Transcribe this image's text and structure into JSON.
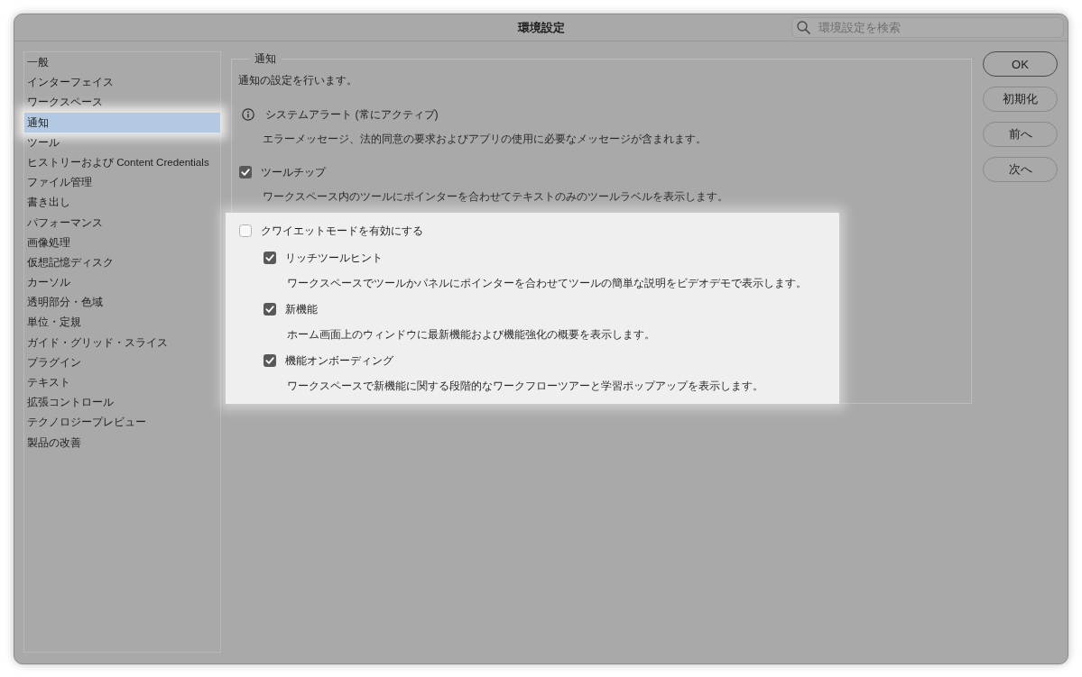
{
  "window": {
    "title": "環境設定"
  },
  "search": {
    "placeholder": "環境設定を検索"
  },
  "sidebar": {
    "items": [
      {
        "label": "一般",
        "selected": false,
        "highlighted": false
      },
      {
        "label": "インターフェイス",
        "selected": false,
        "highlighted": false
      },
      {
        "label": "ワークスペース",
        "selected": false,
        "highlighted": false
      },
      {
        "label": "通知",
        "selected": true,
        "highlighted": true
      },
      {
        "label": "ツール",
        "selected": false,
        "highlighted": false
      },
      {
        "label": "ヒストリーおよび Content Credentials",
        "selected": false,
        "highlighted": false
      },
      {
        "label": "ファイル管理",
        "selected": false,
        "highlighted": false
      },
      {
        "label": "書き出し",
        "selected": false,
        "highlighted": false
      },
      {
        "label": "パフォーマンス",
        "selected": false,
        "highlighted": false
      },
      {
        "label": "画像処理",
        "selected": false,
        "highlighted": false
      },
      {
        "label": "仮想記憶ディスク",
        "selected": false,
        "highlighted": false
      },
      {
        "label": "カーソル",
        "selected": false,
        "highlighted": false
      },
      {
        "label": "透明部分・色域",
        "selected": false,
        "highlighted": false
      },
      {
        "label": "単位・定規",
        "selected": false,
        "highlighted": false
      },
      {
        "label": "ガイド・グリッド・スライス",
        "selected": false,
        "highlighted": false
      },
      {
        "label": "プラグイン",
        "selected": false,
        "highlighted": false
      },
      {
        "label": "テキスト",
        "selected": false,
        "highlighted": false
      },
      {
        "label": "拡張コントロール",
        "selected": false,
        "highlighted": false
      },
      {
        "label": "テクノロジープレビュー",
        "selected": false,
        "highlighted": false
      },
      {
        "label": "製品の改善",
        "selected": false,
        "highlighted": false
      }
    ]
  },
  "panel": {
    "legend": "通知",
    "intro": "通知の設定を行います。",
    "settings": [
      {
        "kind": "info",
        "label": "システムアラート (常にアクティブ)",
        "description": "エラーメッセージ、法的同意の要求およびアプリの使用に必要なメッセージが含まれます。",
        "highlighted": false
      },
      {
        "kind": "checkbox",
        "label": "ツールチップ",
        "checked": true,
        "description": "ワークスペース内のツールにポインターを合わせてテキストのみのツールラベルを表示します。",
        "highlighted": false
      },
      {
        "kind": "checkbox",
        "label": "クワイエットモードを有効にする",
        "checked": false,
        "highlighted": true,
        "children": [
          {
            "kind": "checkbox",
            "label": "リッチツールヒント",
            "checked": true,
            "description": "ワークスペースでツールかパネルにポインターを合わせてツールの簡単な説明をビデオデモで表示します。"
          },
          {
            "kind": "checkbox",
            "label": "新機能",
            "checked": true,
            "description": "ホーム画面上のウィンドウに最新機能および機能強化の概要を表示します。"
          },
          {
            "kind": "checkbox",
            "label": "機能オンボーディング",
            "checked": true,
            "description": "ワークスペースで新機能に関する段階的なワークフローツアーと学習ポップアップを表示します。"
          }
        ]
      }
    ]
  },
  "buttons": [
    {
      "label": "OK",
      "default": true
    },
    {
      "label": "初期化",
      "default": false
    },
    {
      "label": "前へ",
      "default": false
    },
    {
      "label": "次へ",
      "default": false
    }
  ]
}
